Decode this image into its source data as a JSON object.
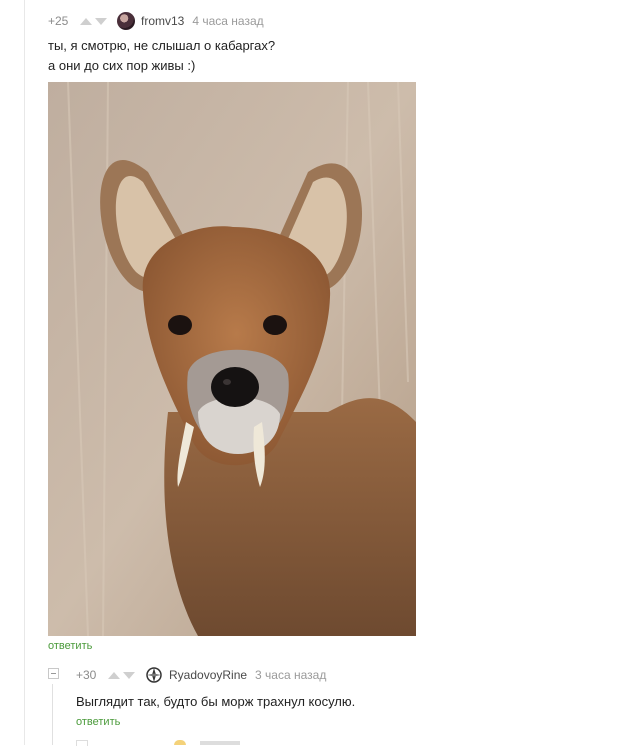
{
  "comment1": {
    "rating": "+25",
    "username": "fromv13",
    "time": "4 часа назад",
    "text_line1": "ты, я смотрю, не слышал о кабаргах?",
    "text_line2": "а они до сих пор живы :)",
    "reply_label": "ответить",
    "avatar_icon": "avatar-photo",
    "photo_subject": "deer-with-fangs-photo"
  },
  "comment2": {
    "rating": "+30",
    "username": "RyadovoyRine",
    "time": "3 часа назад",
    "text": "Выглядит так, будто бы морж трахнул косулю.",
    "reply_label": "ответить",
    "avatar_icon": "compass-avatar-icon"
  },
  "colors": {
    "reply_link": "#4a9a3a",
    "meta_text": "#8b8b8b",
    "vote_arrow": "#cfcfcf"
  }
}
